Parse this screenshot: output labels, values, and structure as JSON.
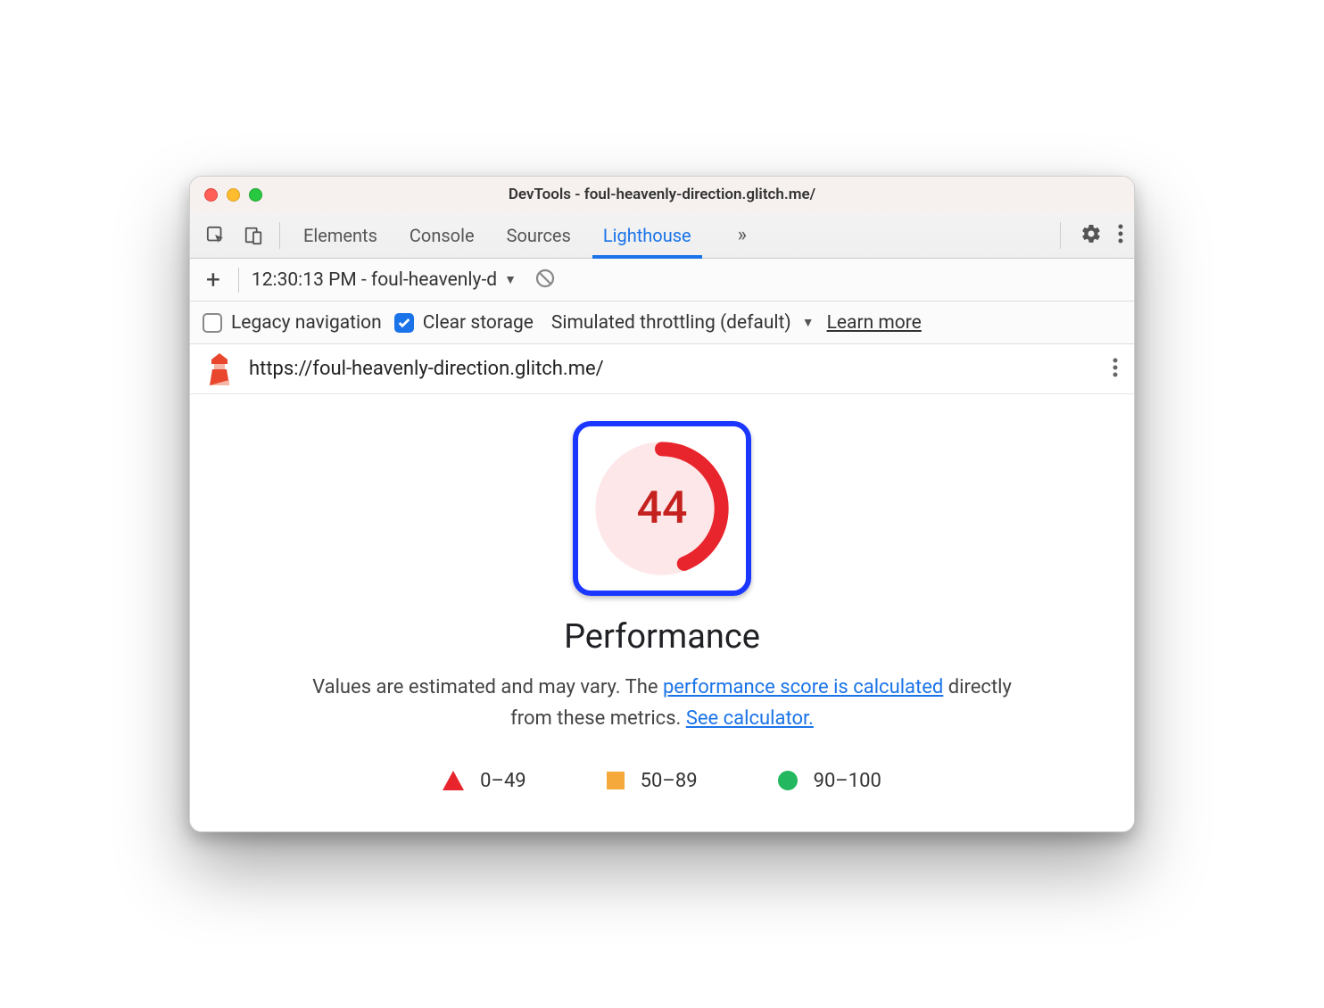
{
  "window": {
    "title": "DevTools - foul-heavenly-direction.glitch.me/"
  },
  "tabs": {
    "elements": "Elements",
    "console": "Console",
    "sources": "Sources",
    "lighthouse": "Lighthouse"
  },
  "subbar": {
    "report_label": "12:30:13 PM - foul-heavenly-d"
  },
  "options": {
    "legacy_label": "Legacy navigation",
    "clear_label": "Clear storage",
    "throttle_label": "Simulated throttling (default)",
    "learn_more": "Learn more"
  },
  "url": "https://foul-heavenly-direction.glitch.me/",
  "report": {
    "score": "44",
    "category": "Performance",
    "desc_prefix": "Values are estimated and may vary. The ",
    "link1": "performance score is calculated",
    "desc_mid": " directly from these metrics. ",
    "link2": "See calculator."
  },
  "legend": {
    "low": "0–49",
    "mid": "50–89",
    "high": "90–100"
  }
}
